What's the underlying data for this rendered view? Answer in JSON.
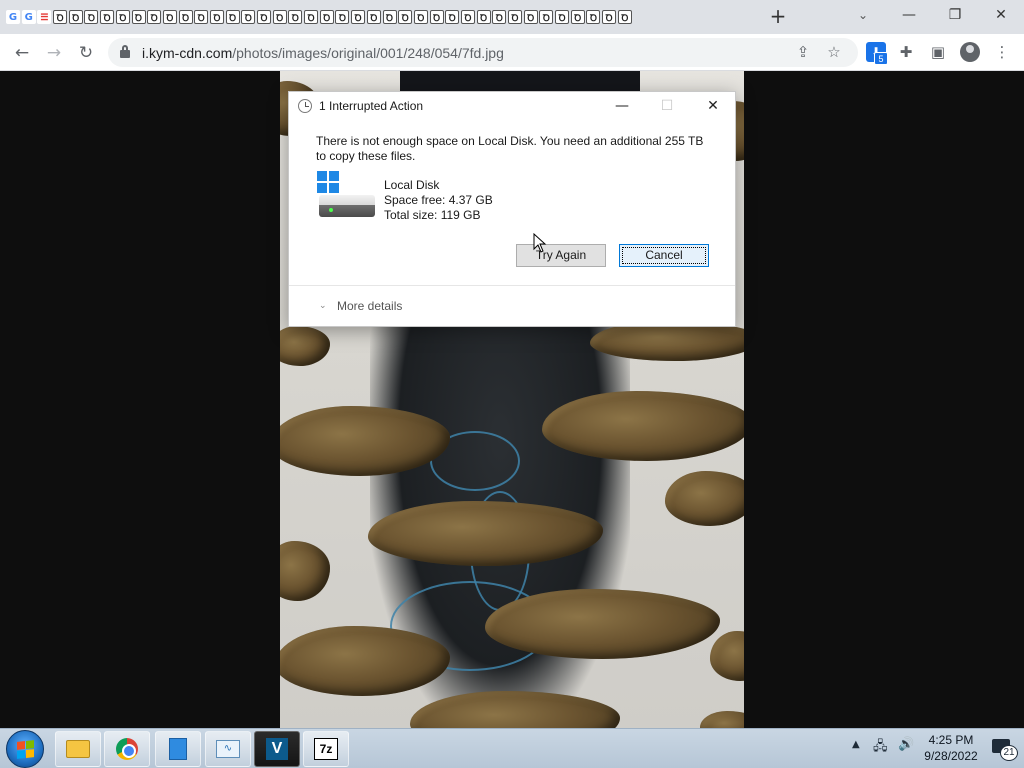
{
  "browser": {
    "tab_icons": [
      "google-g",
      "google-g",
      "red-s"
    ],
    "tab_glyph": "Ꝺ",
    "tab_glyph_count": 37,
    "new_tab": "+",
    "tab_search": "⌄",
    "window": {
      "minimize": "—",
      "restore": "❐",
      "close": "✕"
    },
    "nav": {
      "back": "←",
      "forward": "→",
      "reload": "↻"
    },
    "url_host": "i.kym-cdn.com",
    "url_path": "/photos/images/original/001/248/054/7fd.jpg",
    "download_badge": "5"
  },
  "dialog": {
    "title": "1 Interrupted Action",
    "message": "There is not enough space on Local Disk. You need an additional 255 TB to copy these files.",
    "drive_name": "Local Disk",
    "space_free": "Space free: 4.37 GB",
    "total_size": "Total size: 119 GB",
    "try_again": "Try Again",
    "cancel": "Cancel",
    "more_details": "More details",
    "controls": {
      "minimize": "—",
      "maximize": "☐",
      "close": "✕"
    }
  },
  "taskbar": {
    "apps": [
      "file-explorer",
      "chrome",
      "notepad",
      "resource-monitor",
      "vortex",
      "7-zip"
    ],
    "clock_time": "4:25 PM",
    "clock_date": "9/28/2022",
    "notifications_count": "21",
    "colors": {
      "start": "#1f6fc1",
      "accent": "#0078d7"
    }
  }
}
